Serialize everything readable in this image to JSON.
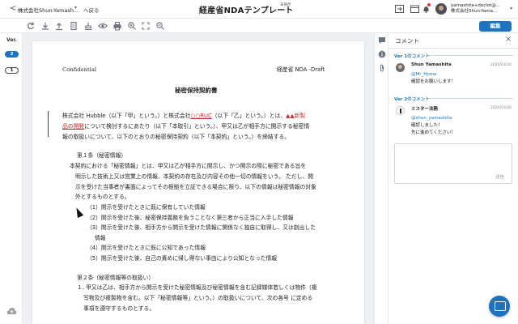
{
  "header": {
    "back_chevron": "<",
    "company": "株式会社Shun-Yamash...",
    "caret": "▾",
    "back_label": "へ戻る",
    "title": "経産省NDAテンプレート",
    "title_badge_top": "未保存",
    "title_badge_bottom": "...",
    "user_email_line1": "yamashita+doclot@...",
    "user_email_line2": "株式会社Shun-Yama...",
    "icons": [
      "share-icon",
      "bell-icon",
      "calendar-icon",
      "help-icon",
      "notification-icon"
    ]
  },
  "toolbar": {
    "tools": [
      "refresh-icon",
      "download-icon",
      "upload-icon",
      "print-preview-icon",
      "stamp-icon",
      "eye-icon",
      "print-icon",
      "zoom-in-icon",
      "fit-icon",
      "zoom-out-icon"
    ],
    "edit_label": "編集"
  },
  "versions": {
    "label": "Ver.",
    "items": [
      "2",
      "1"
    ]
  },
  "document": {
    "header_left": "Confidential",
    "header_right": "経産省 NDA -Draft",
    "title": "秘密保持契約書",
    "intro_1a": "株式会社 Hubble（以下「甲」という。）と株式会社",
    "intro_1b": "○○RUC",
    "intro_1c": "（以下「乙」という。）とは、",
    "intro_1d": "▲▲新製",
    "intro_2a": "品の開発",
    "intro_2b": "について検討するにあたり（以下「本取引」という。）、甲又は乙が相手方に開示する秘密情",
    "intro_3": "報の取扱いについて、以下のとおりの秘密保持契約（以下「本契約」という。）を締結する。",
    "art1_title": "第１条（秘密情報）",
    "art1_p1": "本契約における「秘密情報」とは、甲又は乙が相手方に開示し、かつ開示の際に秘密である旨を",
    "art1_p2": "明示した技術上又は営業上の情報、本契約の存在及び内容その他一切の情報をいう。 ただし、開",
    "art1_p3": "示を受けた当事者が書面によってその根拠を立証できる場合に限り、以下の情報は秘密情報の対象",
    "art1_p4": "外とするものとする。",
    "art1_items": [
      "（1）開示を受けたときに既に保有していた情報",
      "（2）開示を受けた後、秘密保持義務を負うことなく第三者から正当に入手した情報",
      "（3）開示を受けた後、相手方から開示を受けた情報に関係なく独自に取得し、又は創出した",
      "（4）開示を受けたときに既に公知であった情報",
      "（5）開示を受けた後、自己の責めに帰し得ない事由により公知となった情報"
    ],
    "art1_item3_cont": "情報",
    "art2_title": "第２条（秘密情報等の取扱い）",
    "art2_p1": "１. 甲又は乙は、相手方から開示を受けた秘密情報及び秘密情報を含む記録媒体若しくは物件（複",
    "art2_p2": "写物及び複製物を含む。以下「秘密情報等」という。）の取扱いについて、次の各号 に定める",
    "art2_p3": "事項を遵守するものとする。"
  },
  "comments": {
    "title": "コメント",
    "close": "×",
    "groups": [
      {
        "heading": "Ver 1のコメント",
        "author": "Shun Yamashita",
        "date": "2020/03/26",
        "mention": "@Mr_Home",
        "body": "確認をお願いします！"
      },
      {
        "heading": "Ver 2のコメント",
        "author": "ミスター法務",
        "date": "2020/03/26",
        "mention": "@shun_yamashita",
        "body1": "確認しました！",
        "body2": "先に進めてください！"
      }
    ],
    "send_label": "送信"
  },
  "colors": {
    "accent": "#1e73be",
    "redline": "#c62828"
  }
}
